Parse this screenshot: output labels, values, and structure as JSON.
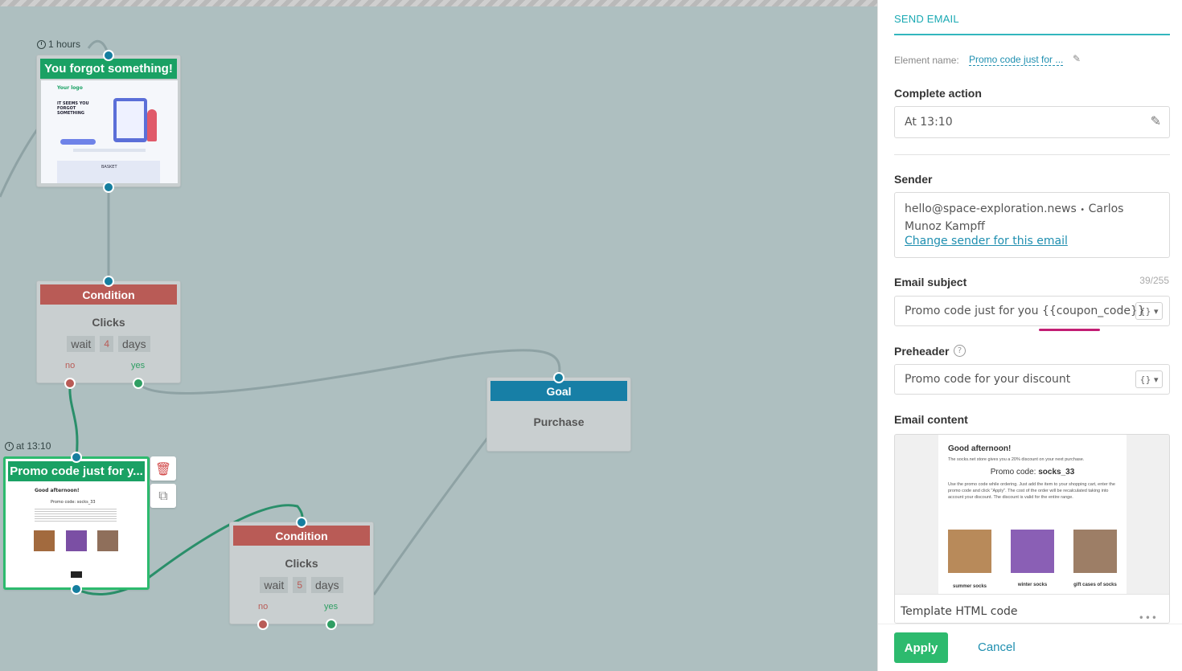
{
  "canvas": {
    "email1": {
      "delay": "1 hours",
      "title": "You forgot something!"
    },
    "cond1": {
      "title": "Condition",
      "event": "Clicks",
      "wait": "wait",
      "count": "4",
      "unit": "days",
      "no": "no",
      "yes": "yes"
    },
    "goal": {
      "title": "Goal",
      "event": "Purchase"
    },
    "email2": {
      "delay": "at 13:10",
      "title": "Promo code just for y...",
      "thumb_greeting": "Good afternoon!",
      "thumb_code": "Promo code: socks_33"
    },
    "cond2": {
      "title": "Condition",
      "event": "Clicks",
      "wait": "wait",
      "count": "5",
      "unit": "days",
      "no": "no",
      "yes": "yes"
    },
    "email1_thumb": {
      "logo": "Your logo",
      "headline": "IT SEEMS YOU FORGOT SOMETHING",
      "basket": "BASKET"
    }
  },
  "panel": {
    "title": "SEND EMAIL",
    "element_name_label": "Element name:",
    "element_name_value": "Promo code just for ...",
    "complete_action_label": "Complete action",
    "complete_action_value": "At 13:10",
    "sender_label": "Sender",
    "sender_email": "hello@space-exploration.news",
    "sender_dot": "•",
    "sender_name": "Carlos Munoz Kampff",
    "change_sender": "Change sender for this email",
    "subject_label": "Email subject",
    "subject_counter": "39/255",
    "subject_value": "Promo code just for you {{coupon_code}}",
    "preheader_label": "Preheader",
    "preheader_value": "Promo code for your discount",
    "var_button": "{} ▾",
    "content_label": "Email content",
    "preview": {
      "greeting": "Good afternoon!",
      "intro": "The socks.net store gives you a 20% discount on your next purchase.",
      "code_prefix": "Promo code:",
      "code": "socks_33",
      "body": "Use the promo code while ordering. Just add the item to your shopping cart, enter the promo code and click \"Apply\". The cost of the order will be recalculated taking into account your discount. The discount is valid for the entire range.",
      "products": [
        "summer socks",
        "winter socks",
        "gift cases of socks"
      ]
    },
    "template_label": "Template HTML code",
    "apply": "Apply",
    "cancel": "Cancel"
  },
  "colors": {
    "canvas_bg": "#aebfc0",
    "green": "#1aa164",
    "red": "#b95b56",
    "blue": "#177fa6",
    "teal_accent": "#1aa9b3",
    "apply_green": "#2dba6e"
  }
}
